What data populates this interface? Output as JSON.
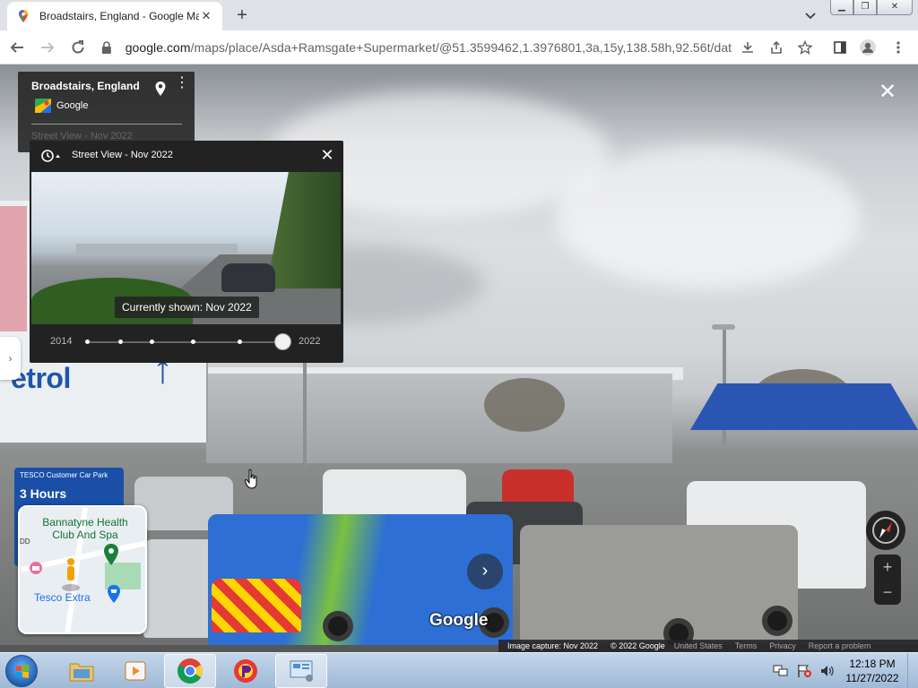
{
  "browser": {
    "tab_title": "Broadstairs, England - Google Maps",
    "new_tab": "+",
    "url_host": "google.com",
    "url_path": "/maps/place/Asda+Ramsgate+Supermarket/@51.3599462,1.3976801,3a,15y,138.58h,92.56t/dat...",
    "window_buttons": [
      "minimize",
      "restore",
      "close"
    ]
  },
  "street_view": {
    "location_title": "Broadstairs, England",
    "owner": "Google",
    "collapsed_label": "Street View - Nov 2022",
    "timeline": {
      "header_label": "Street View - Nov 2022",
      "currently_shown": "Currently shown: Nov 2022",
      "start_year": "2014",
      "end_year": "2022",
      "stops": [
        0,
        0.17,
        0.33,
        0.54,
        0.78,
        1.0
      ],
      "selected_stop": 1.0
    },
    "scene_text": {
      "petrol": "etrol",
      "tesco_sign_top": "TESCO Customer Car Park",
      "tesco_sign_main": "3 Hours"
    },
    "minimap": {
      "poi_1": "Bannatyne Health Club And Spa",
      "poi_2": "Tesco Extra",
      "edge_label": "DD"
    },
    "watermark": "Google",
    "footer": {
      "capture": "Image capture: Nov 2022",
      "copyright": "© 2022 Google",
      "region": "United States",
      "terms": "Terms",
      "privacy": "Privacy",
      "report": "Report a problem"
    }
  },
  "taskbar": {
    "time": "12:18 PM",
    "date": "11/27/2022"
  },
  "colors": {
    "accent_blue": "#1a73e8",
    "panel_bg": "#222222",
    "poi_green": "#137333"
  }
}
